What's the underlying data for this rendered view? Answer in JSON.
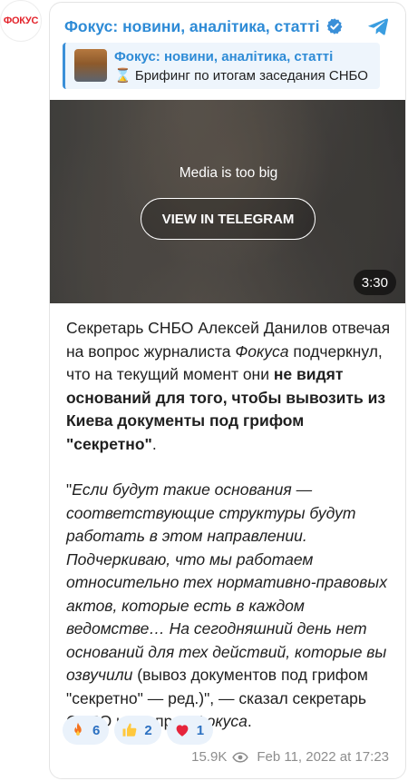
{
  "channel": {
    "avatar_text": "ФОКУС",
    "name": "Фокус: новини, аналітика, статті"
  },
  "reply": {
    "title": "Фокус: новини, аналітика, статті",
    "icon": "⌛",
    "preview": "Брифинг по итогам заседания СНБО"
  },
  "media": {
    "message": "Media is too big",
    "button_label": "VIEW IN TELEGRAM",
    "duration": "3:30"
  },
  "post": {
    "p1_a": "Секретарь СНБО Алексей Данилов отвечая на вопрос журналиста ",
    "p1_em": "Фокуса",
    "p1_b": " подчеркнул, что на текущий момент они ",
    "p1_strong": "не видят оснований для того, чтобы вывозить из Киева документы под грифом \"секретно\"",
    "p1_end": ".",
    "p2_open": "\"",
    "p2_quote": "Если будут такие основания — соответствующие структуры будут работать в этом направлении. Подчеркиваю, что мы работаем относительно тех нормативно-правовых актов, которые есть в каждом ведомстве… На сегодняшний день нет оснований для тех действий, которые вы озвучили",
    "p2_mid": " (вывоз документов под грифом \"секретно\" — ред.)\", — сказал секретарь СНБО на вопрос ",
    "p2_em": "Фокуса",
    "p2_end": "."
  },
  "reactions": [
    {
      "emoji": "fire",
      "count": "6"
    },
    {
      "emoji": "thumbs-up",
      "count": "2"
    },
    {
      "emoji": "heart",
      "count": "1"
    }
  ],
  "footer": {
    "views": "15.9K",
    "date": "Feb 11, 2022 at 17:23"
  },
  "colors": {
    "accent": "#2e8bd6",
    "reaction_bg": "#eaf2fb",
    "reaction_text": "#2b70c1",
    "brand_red": "#e3232b"
  }
}
